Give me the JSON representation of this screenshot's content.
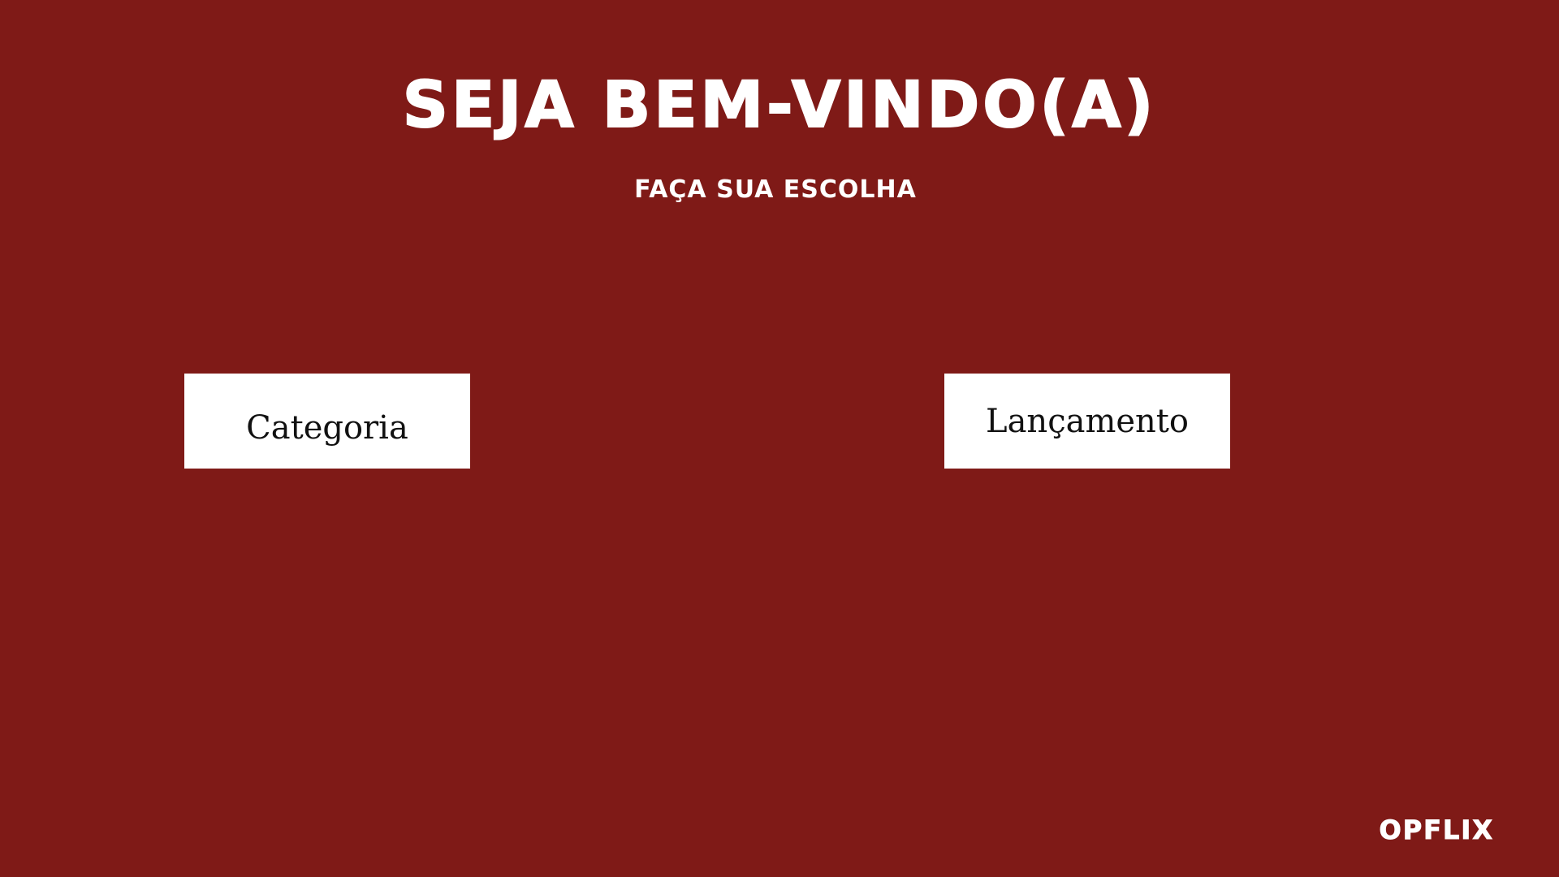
{
  "colors": {
    "background": "#7f1a17",
    "text": "#ffffff",
    "button_background": "#ffffff",
    "button_text": "#111111"
  },
  "header": {
    "title": "SEJA BEM-VINDO(A)",
    "subtitle": "FAÇA SUA ESCOLHA"
  },
  "choices": {
    "categoria_label": "Categoria",
    "lancamento_label": "Lançamento"
  },
  "brand": {
    "logo_text": "OPFLIX"
  }
}
